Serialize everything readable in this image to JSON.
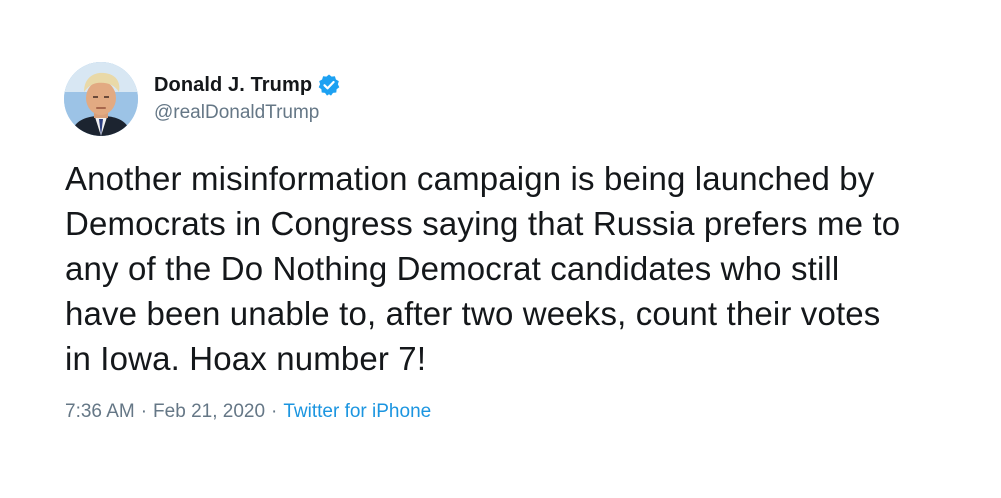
{
  "author": {
    "display_name": "Donald J. Trump",
    "handle": "@realDonaldTrump",
    "verified_icon": "verified-badge-icon",
    "avatar": "profile-avatar"
  },
  "tweet": {
    "text": "Another misinformation campaign is being launched by\nDemocrats in Congress saying that Russia prefers me to\nany of the Do Nothing Democrat candidates who still\nhave been unable to, after two weeks, count their votes\nin Iowa. Hoax number 7!",
    "time": "7:36 AM",
    "separator": "·",
    "date": "Feb 21, 2020",
    "source": "Twitter for iPhone"
  },
  "colors": {
    "text": "#14171a",
    "secondary": "#657786",
    "link": "#1b95e0",
    "verified": "#1da1f2"
  }
}
